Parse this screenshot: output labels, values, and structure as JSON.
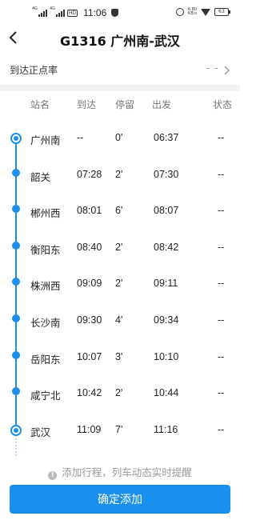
{
  "status_bar": {
    "signal1": "4G",
    "signal2": "4G",
    "hd": "HD",
    "time": "11:06",
    "net_speed": "6.80\nKB/s",
    "battery": "63"
  },
  "header": {
    "title": "G1316 广州南-武汉"
  },
  "on_time": {
    "label": "到达正点率",
    "value": "- -"
  },
  "columns": [
    "站名",
    "到达",
    "停留",
    "出发",
    "状态"
  ],
  "stops": [
    {
      "name": "广州南",
      "arrive": "--",
      "stay": "0'",
      "depart": "06:37",
      "status": "--",
      "marker": "start"
    },
    {
      "name": "韶关",
      "arrive": "07:28",
      "stay": "2'",
      "depart": "07:30",
      "status": "--",
      "marker": "dot"
    },
    {
      "name": "郴州西",
      "arrive": "08:01",
      "stay": "6'",
      "depart": "08:07",
      "status": "--",
      "marker": "dot"
    },
    {
      "name": "衡阳东",
      "arrive": "08:40",
      "stay": "2'",
      "depart": "08:42",
      "status": "--",
      "marker": "dot"
    },
    {
      "name": "株洲西",
      "arrive": "09:09",
      "stay": "2'",
      "depart": "09:11",
      "status": "--",
      "marker": "dot"
    },
    {
      "name": "长沙南",
      "arrive": "09:30",
      "stay": "4'",
      "depart": "09:34",
      "status": "--",
      "marker": "dot"
    },
    {
      "name": "岳阳东",
      "arrive": "10:07",
      "stay": "3'",
      "depart": "10:10",
      "status": "--",
      "marker": "dot"
    },
    {
      "name": "咸宁北",
      "arrive": "10:42",
      "stay": "2'",
      "depart": "10:44",
      "status": "--",
      "marker": "dot"
    },
    {
      "name": "武汉",
      "arrive": "11:09",
      "stay": "7'",
      "depart": "11:16",
      "status": "--",
      "marker": "end"
    }
  ],
  "tip": "添加行程，列车动态实时提醒",
  "confirm_label": "确定添加",
  "colors": {
    "accent": "#1a90ee"
  }
}
